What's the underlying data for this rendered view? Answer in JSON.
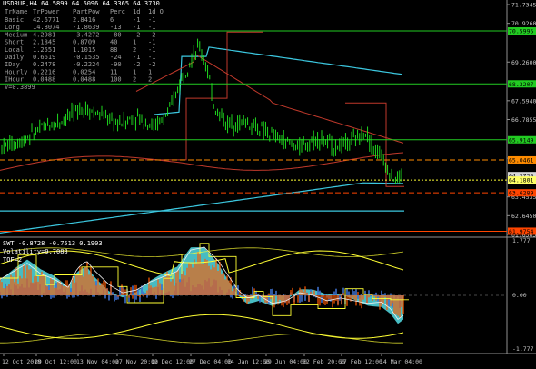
{
  "window": {
    "title": "USDRUB,H4  64.5899 64.6096 64.3365 64.3730"
  },
  "info_table": {
    "header": [
      "TrName",
      "TrPower",
      "PartPow",
      "Perc",
      "1d",
      "1d_O"
    ],
    "rows": [
      [
        "Basic",
        "42.6771",
        "2.8416",
        "6",
        "-1",
        "-1"
      ],
      [
        "Long",
        "14.8074",
        "-1.8639",
        "-13",
        "-1",
        "-1"
      ],
      [
        "Medium",
        "4.2981",
        "-3.4272",
        "-80",
        "-2",
        "-2"
      ],
      [
        "Short",
        "2.1845",
        "0.8709",
        "40",
        "1",
        "-1"
      ],
      [
        "Local",
        "1.2551",
        "1.1015",
        "88",
        "2",
        "-1"
      ],
      [
        "Daily",
        "0.6619",
        "-0.1535",
        "-24",
        "-1",
        "-1"
      ],
      [
        "IDay",
        "0.2478",
        "-0.2224",
        "-90",
        "-2",
        "-2"
      ],
      [
        "Hourly",
        "0.2216",
        "0.0254",
        "11",
        "1",
        "1"
      ],
      [
        "IHour",
        "0.0488",
        "0.0488",
        "100",
        "2",
        "2"
      ]
    ],
    "footer": "V=0.3899"
  },
  "price_axis": {
    "ticks": [
      "71.7345",
      "70.9260",
      "69.2600",
      "67.5940",
      "66.7855",
      "65.1195",
      "63.4535",
      "62.6450",
      "61.8365"
    ],
    "tags": [
      {
        "value": "70.5995",
        "color": "#22cc22"
      },
      {
        "value": "68.3207",
        "color": "#22cc22"
      },
      {
        "value": "65.9149",
        "color": "#22cc22"
      },
      {
        "value": "65.0461",
        "color": "#ff8c00"
      },
      {
        "value": "64.3730",
        "color": "#d8d8d8"
      },
      {
        "value": "64.1801",
        "color": "#ffff66"
      },
      {
        "value": "63.6289",
        "color": "#ff4500"
      },
      {
        "value": "61.9754",
        "color": "#ff4500"
      }
    ]
  },
  "indicator": {
    "title": "SWT -0.8728 -0.7513 0.1903",
    "line2": "Volatility=9.7088",
    "line3": "TOF=2",
    "ticks": [
      "1.777",
      "0.00",
      "-1.777"
    ]
  },
  "time_axis": {
    "labels": [
      "12 Oct 2018",
      "29 Oct 12:00",
      "13 Nov 04:00",
      "27 Nov 20:00",
      "12 Dec 12:00",
      "27 Dec 04:00",
      "14 Jan 12:00",
      "29 Jun 04:00",
      "12 Feb 20:00",
      "27 Feb 12:00",
      "14 Mar 04:00"
    ]
  },
  "colors": {
    "candles": "#22ee22",
    "ma_cyan": "#3cc8e0",
    "ma_red": "#c0392b",
    "level_green": "#22cc22",
    "level_orange": "#ff8c00",
    "level_red": "#ff4500",
    "osc_orange": "#ff5a00",
    "osc_cyan": "#4fd0d8",
    "osc_blue": "#3c6ecc",
    "yellow": "#ffff33"
  }
}
